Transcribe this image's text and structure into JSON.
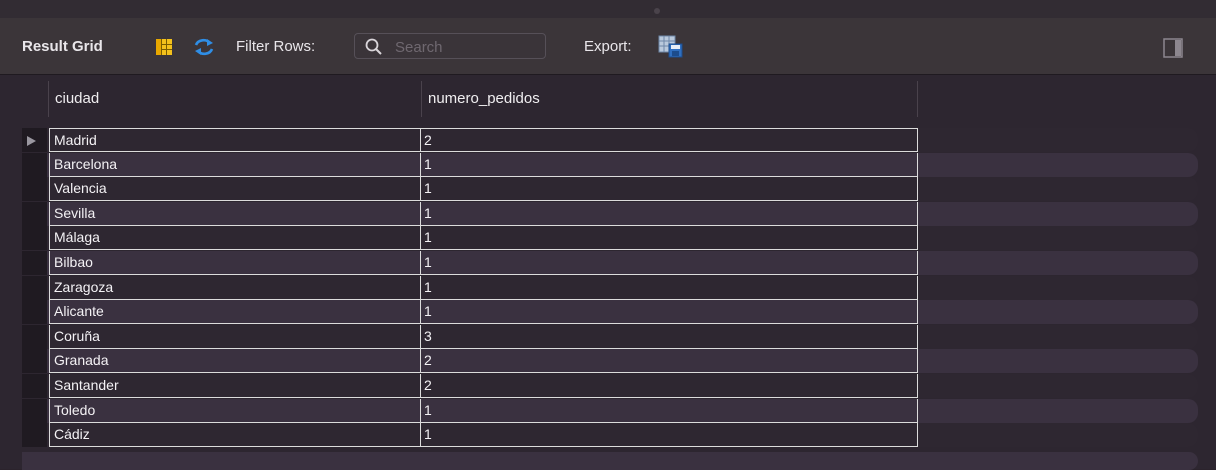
{
  "toolbar": {
    "result_grid_label": "Result Grid",
    "filter_rows_label": "Filter Rows:",
    "search_placeholder": "Search",
    "export_label": "Export:"
  },
  "icons": {
    "grid_view": "grid-view-icon",
    "refresh": "refresh-icon",
    "search": "search-icon",
    "export": "export-icon",
    "panel_toggle": "panel-toggle-icon"
  },
  "colors": {
    "background": "#2b232c",
    "toolbar": "#3b3539",
    "row_alt": "#3a3140",
    "accent_blue": "#2f8ee6",
    "grid_icon_yellow": "#f3c11c"
  },
  "table": {
    "columns": [
      "ciudad",
      "numero_pedidos"
    ],
    "rows": [
      {
        "ciudad": "Madrid",
        "numero_pedidos": "2"
      },
      {
        "ciudad": "Barcelona",
        "numero_pedidos": "1"
      },
      {
        "ciudad": "Valencia",
        "numero_pedidos": "1"
      },
      {
        "ciudad": "Sevilla",
        "numero_pedidos": "1"
      },
      {
        "ciudad": "Málaga",
        "numero_pedidos": "1"
      },
      {
        "ciudad": "Bilbao",
        "numero_pedidos": "1"
      },
      {
        "ciudad": "Zaragoza",
        "numero_pedidos": "1"
      },
      {
        "ciudad": "Alicante",
        "numero_pedidos": "1"
      },
      {
        "ciudad": "Coruña",
        "numero_pedidos": "3"
      },
      {
        "ciudad": "Granada",
        "numero_pedidos": "2"
      },
      {
        "ciudad": "Santander",
        "numero_pedidos": "2"
      },
      {
        "ciudad": "Toledo",
        "numero_pedidos": "1"
      },
      {
        "ciudad": "Cádiz",
        "numero_pedidos": "1"
      }
    ]
  }
}
